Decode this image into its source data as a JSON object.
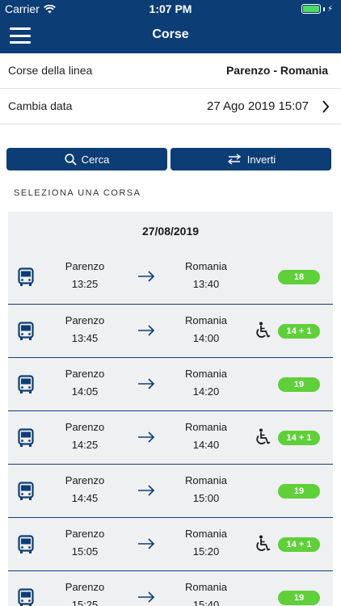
{
  "status": {
    "carrier": "Carrier",
    "time": "1:07 PM",
    "battery_level": 1.0
  },
  "nav": {
    "title": "Corse",
    "menu_icon": "hamburger-icon"
  },
  "info": {
    "line_label": "Corse della linea",
    "line_value": "Parenzo - Romania",
    "date_label": "Cambia data",
    "date_value": "27 Ago 2019 15:07"
  },
  "actions": {
    "search_label": "Cerca",
    "invert_label": "Inverti"
  },
  "section_label": "SELEZIONA UNA CORSA",
  "list": {
    "date": "27/08/2019",
    "trips": [
      {
        "from": "Parenzo",
        "dep": "13:25",
        "to": "Romania",
        "arr": "13:40",
        "wheelchair": false,
        "seats": "18"
      },
      {
        "from": "Parenzo",
        "dep": "13:45",
        "to": "Romania",
        "arr": "14:00",
        "wheelchair": true,
        "seats": "14 + 1"
      },
      {
        "from": "Parenzo",
        "dep": "14:05",
        "to": "Romania",
        "arr": "14:20",
        "wheelchair": false,
        "seats": "19"
      },
      {
        "from": "Parenzo",
        "dep": "14:25",
        "to": "Romania",
        "arr": "14:40",
        "wheelchair": true,
        "seats": "14 + 1"
      },
      {
        "from": "Parenzo",
        "dep": "14:45",
        "to": "Romania",
        "arr": "15:00",
        "wheelchair": false,
        "seats": "19"
      },
      {
        "from": "Parenzo",
        "dep": "15:05",
        "to": "Romania",
        "arr": "15:20",
        "wheelchair": true,
        "seats": "14 + 1"
      },
      {
        "from": "Parenzo",
        "dep": "15:25",
        "to": "Romania",
        "arr": "15:40",
        "wheelchair": false,
        "seats": "19"
      }
    ]
  },
  "colors": {
    "primary": "#0d3d75",
    "badge": "#5fcf3a",
    "list_bg": "#eff0f2"
  }
}
